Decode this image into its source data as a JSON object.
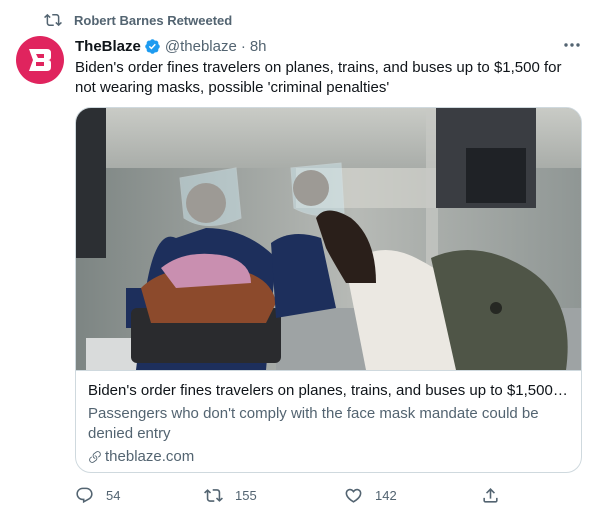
{
  "retweet": {
    "label": "Robert Barnes Retweeted"
  },
  "tweet": {
    "author_name": "TheBlaze",
    "handle": "@theblaze",
    "separator": "·",
    "time": "8h",
    "text": "Biden's order fines travelers on planes, trains, and buses up to $1,500 for not wearing masks, possible 'criminal penalties'",
    "verified": true
  },
  "card": {
    "title": "Biden's order fines travelers on planes, trains, and buses up to $1,500 for...",
    "description": "Passengers who don't comply with the face mask mandate could be denied entry",
    "domain": "theblaze.com",
    "image_icon": "photo-airport-security"
  },
  "actions": {
    "reply_count": "54",
    "retweet_count": "155",
    "like_count": "142"
  },
  "colors": {
    "brand": "#e0245e",
    "verified": "#1d9bf0",
    "muted_text": "#536471",
    "border": "#cfd9de"
  }
}
